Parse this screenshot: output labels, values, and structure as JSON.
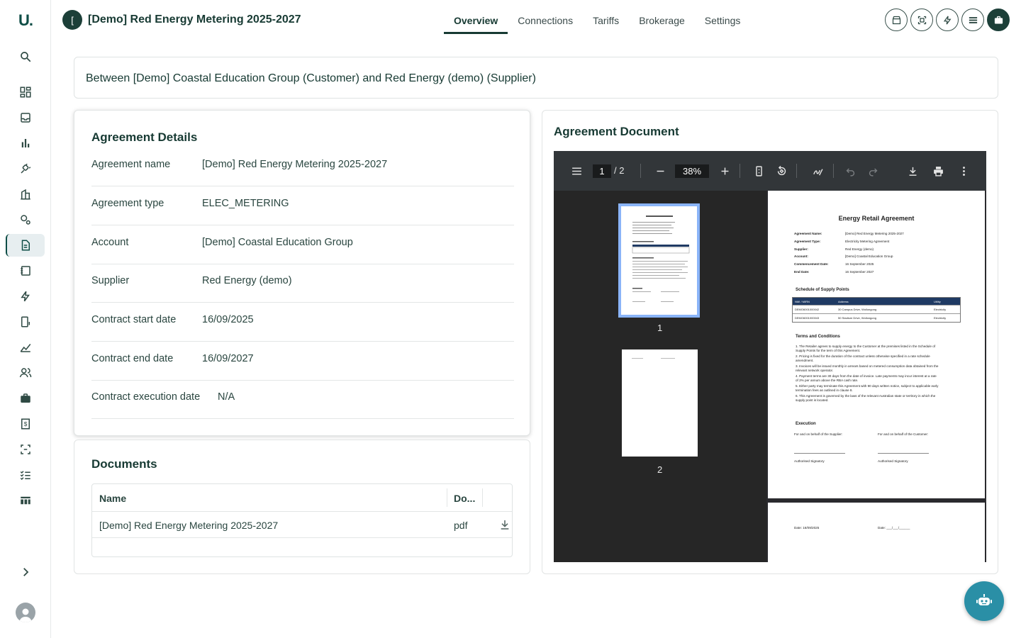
{
  "app": {
    "logo": "U.",
    "title": "[Demo] Red Energy Metering 2025-2027",
    "badge": "["
  },
  "tabs": [
    {
      "label": "Overview",
      "active": true
    },
    {
      "label": "Connections"
    },
    {
      "label": "Tariffs"
    },
    {
      "label": "Brokerage"
    },
    {
      "label": "Settings"
    }
  ],
  "header": {
    "between": "Between [Demo] Coastal Education Group (Customer) and Red Energy (demo) (Supplier)"
  },
  "details": {
    "title": "Agreement Details",
    "rows": [
      {
        "k": "Agreement name",
        "v": "[Demo] Red Energy Metering 2025-2027"
      },
      {
        "k": "Agreement type",
        "v": "ELEC_METERING"
      },
      {
        "k": "Account",
        "v": "[Demo] Coastal Education Group"
      },
      {
        "k": "Supplier",
        "v": "Red Energy (demo)"
      },
      {
        "k": "Contract start date",
        "v": "16/09/2025"
      },
      {
        "k": "Contract end date",
        "v": "16/09/2027"
      },
      {
        "k": "Contract execution date",
        "v": "N/A"
      }
    ]
  },
  "documents": {
    "title": "Documents",
    "col_name": "Name",
    "col_doc": "Do...",
    "rows": [
      {
        "name": "[Demo] Red Energy Metering 2025-2027",
        "type": "pdf"
      }
    ]
  },
  "viewer": {
    "title": "Agreement Document",
    "page": "1",
    "pages": "/  2",
    "zoom": "38%",
    "thumb1": "1",
    "thumb2": "2",
    "doc": {
      "heading": "Energy Retail Agreement",
      "fields": [
        {
          "k": "Agreement Name:",
          "v": "[Demo] Red Energy Metering 2025-2027"
        },
        {
          "k": "Agreement Type:",
          "v": "Electricity Metering Agreement"
        },
        {
          "k": "Supplier:",
          "v": "Red Energy (demo)"
        },
        {
          "k": "Account:",
          "v": "[Demo] Coastal Education Group"
        },
        {
          "k": "Commencement Date:",
          "v": "16 September 2025"
        },
        {
          "k": "End Date:",
          "v": "16 September 2027"
        }
      ],
      "schedule_title": "Schedule of Supply Points",
      "sched_cols": [
        "NMI / MIRN",
        "Address",
        "Utility"
      ],
      "sched_rows": [
        [
          "DEMO6001000042",
          "30 Campus Drive, Wollongong",
          "Electricity"
        ],
        [
          "DEMO6001000043",
          "50 Stadium Drive, Wollongong",
          "Electricity"
        ]
      ],
      "terms_title": "Terms and Conditions",
      "terms": [
        "1. The Retailer agrees to supply energy to the Customer at the premises listed in the Schedule of",
        "Supply Points for the term of this Agreement.",
        "2. Pricing is fixed for the duration of the contract unless otherwise specified in a rate schedule",
        "amendment.",
        "3. Invoices will be issued monthly in arrears based on metered consumption data obtained from the",
        "relevant network operator.",
        "4. Payment terms are 30 days from the date of invoice. Late payments may incur interest at a rate",
        "of 2% per annum above the RBA cash rate.",
        "5. Either party may terminate this Agreement with 90 days written notice, subject to applicable early",
        "termination fees as outlined in clause 8.",
        "6. This Agreement is governed by the laws of the relevant Australian state or territory in which the",
        "supply point is located."
      ],
      "execution_title": "Execution",
      "supplier_sign": "For and on behalf of the Supplier:",
      "customer_sign": "For and on behalf of the Customer:",
      "signatory": "Authorised Signatory",
      "date1": "Date: 16/09/2025",
      "date2": "Date: ___/___/______"
    }
  }
}
